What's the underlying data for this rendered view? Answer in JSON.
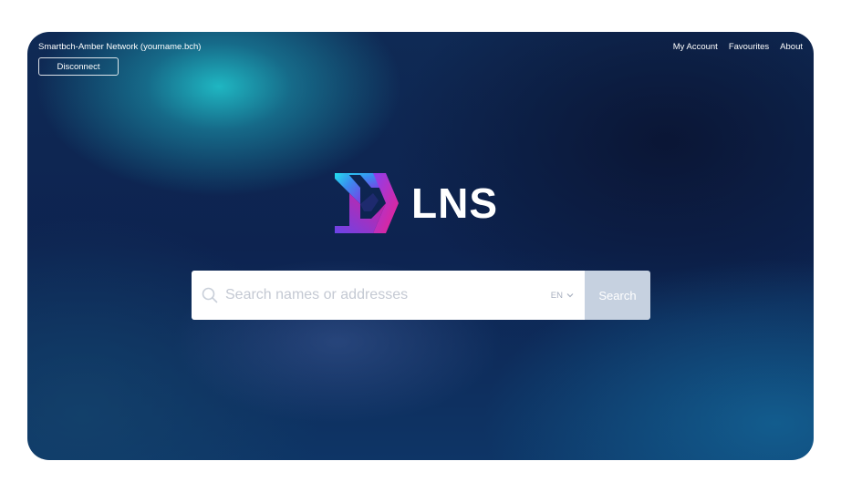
{
  "header": {
    "network_label": "Smartbch-Amber Network (yourname.bch)",
    "disconnect_label": "Disconnect"
  },
  "nav": {
    "items": [
      {
        "label": "My Account"
      },
      {
        "label": "Favourites"
      },
      {
        "label": "About"
      }
    ]
  },
  "logo": {
    "text": "LNS",
    "icon": "lns-logo-mark"
  },
  "search": {
    "placeholder": "Search names or addresses",
    "value": "",
    "language": "EN",
    "button_label": "Search",
    "icon": "search-icon"
  },
  "colors": {
    "accent_cyan": "#1fd4e6",
    "accent_magenta": "#e0198a",
    "accent_purple": "#7b3fe4",
    "search_button": "#c6d1e0",
    "background_dark": "#0f2a55"
  }
}
